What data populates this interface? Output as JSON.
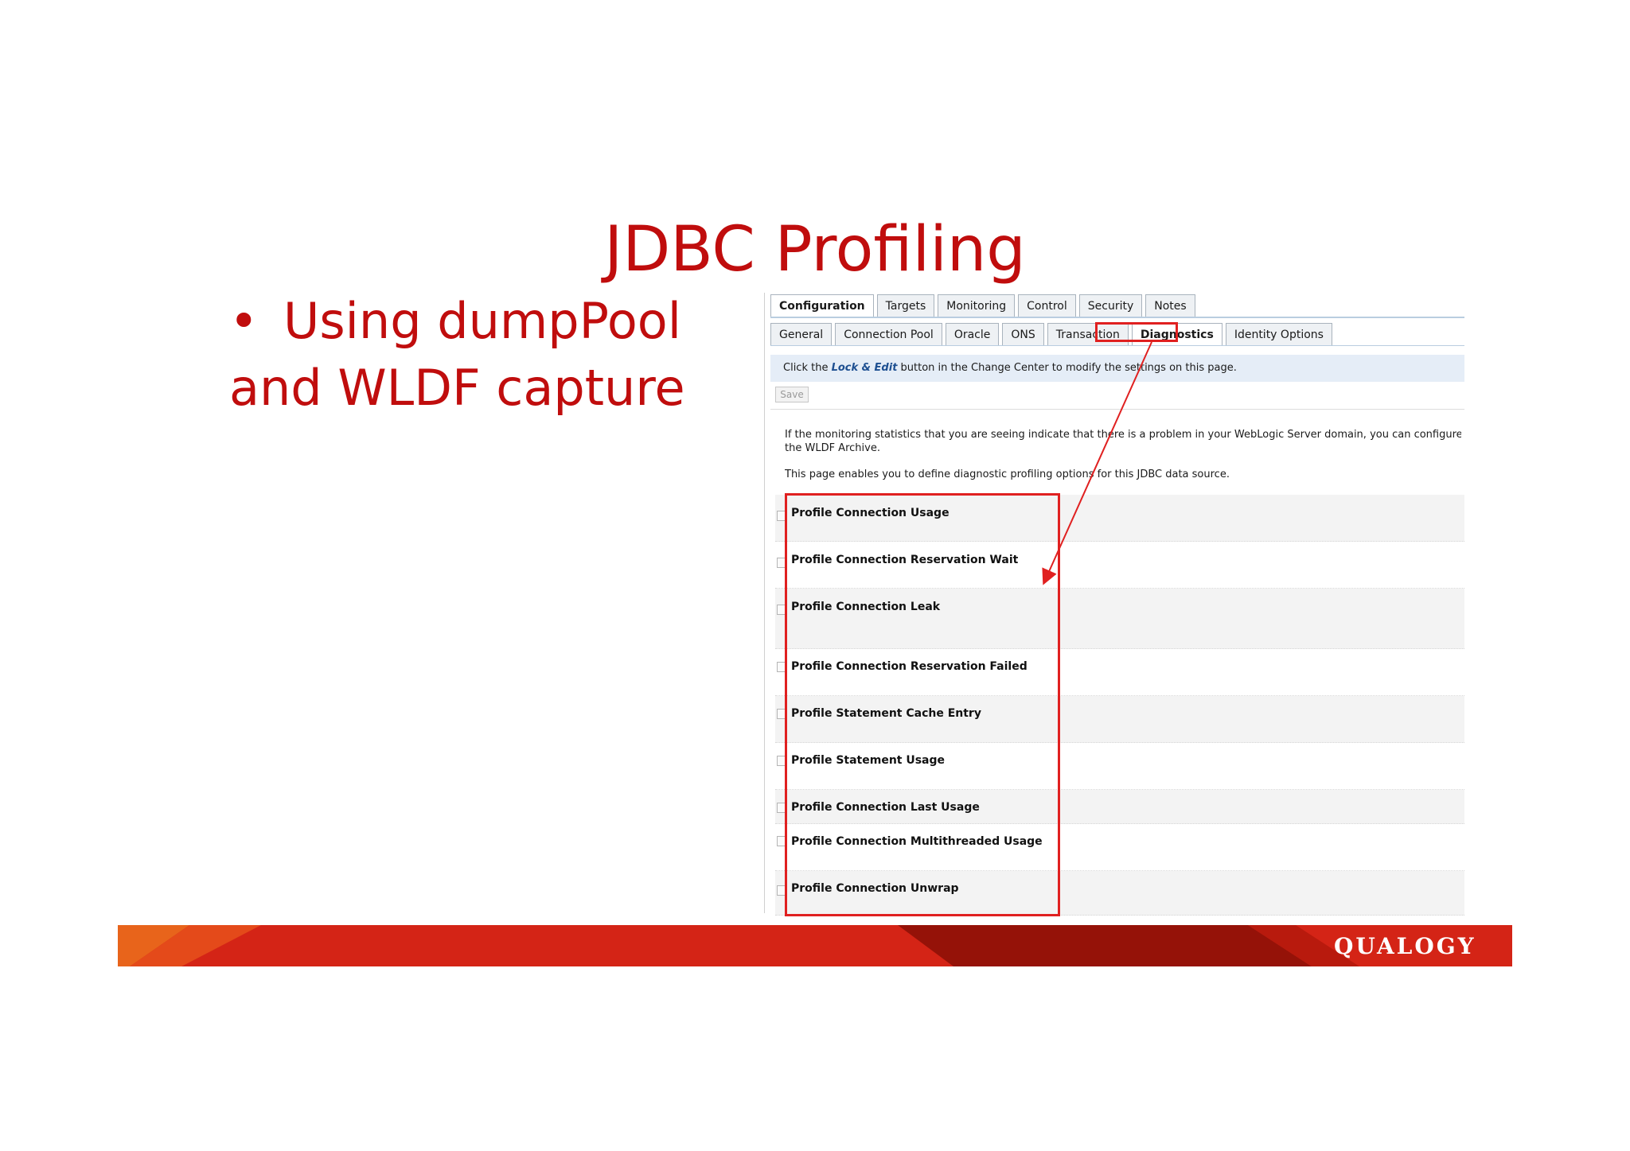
{
  "slide": {
    "title": "JDBC Profiling",
    "bullet_symbol": "•",
    "bullet_line1": "Using dumpPool",
    "bullet_line2": "and WLDF capture"
  },
  "weblogic": {
    "tabs_top": [
      {
        "label": "Configuration",
        "active": true
      },
      {
        "label": "Targets",
        "active": false
      },
      {
        "label": "Monitoring",
        "active": false
      },
      {
        "label": "Control",
        "active": false
      },
      {
        "label": "Security",
        "active": false
      },
      {
        "label": "Notes",
        "active": false
      }
    ],
    "tabs_sub": [
      {
        "label": "General",
        "active": false
      },
      {
        "label": "Connection Pool",
        "active": false
      },
      {
        "label": "Oracle",
        "active": false
      },
      {
        "label": "ONS",
        "active": false
      },
      {
        "label": "Transaction",
        "active": false
      },
      {
        "label": "Diagnostics",
        "active": true
      },
      {
        "label": "Identity Options",
        "active": false
      }
    ],
    "info_prefix": "Click the",
    "info_lock_edit": "Lock & Edit",
    "info_suffix": "button in the Change Center to modify the settings on this page.",
    "save_label": "Save",
    "desc_line1": "If the monitoring statistics that you are seeing indicate that there is a problem in your WebLogic Server domain, you can configure a",
    "desc_line2": "the WLDF Archive.",
    "desc_line3": "This page enables you to define diagnostic profiling options for this JDBC data source.",
    "options": [
      "Profile Connection Usage",
      "Profile Connection Reservation Wait",
      "Profile Connection Leak",
      "Profile Connection Reservation Failed",
      "Profile Statement Cache Entry",
      "Profile Statement Usage",
      "Profile Connection Last Usage",
      "Profile Connection Multithreaded Usage",
      "Profile Connection Unwrap"
    ]
  },
  "footer": {
    "brand": "QUALOGY"
  },
  "colors": {
    "title_red": "#c00d0d",
    "highlight_red": "#e02020",
    "footer_orange": "#e8641b",
    "footer_red": "#d42416",
    "footer_dark_red": "#951208"
  }
}
